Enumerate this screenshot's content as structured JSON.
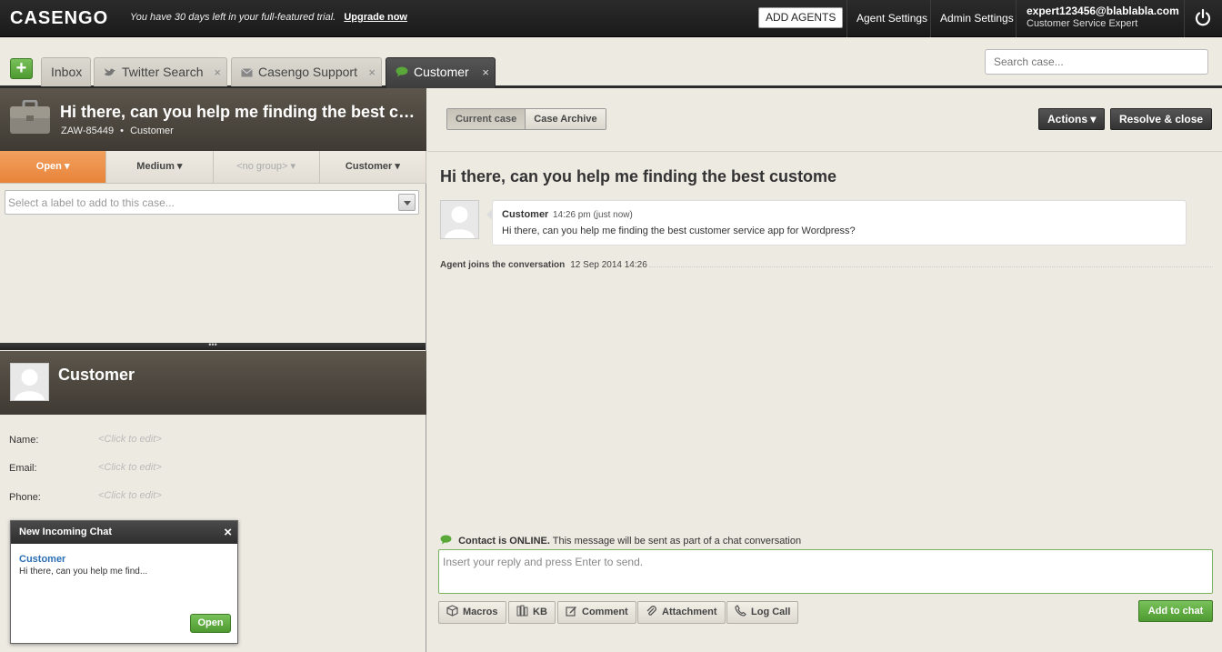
{
  "topbar": {
    "logo": "CASENGO",
    "trial_text": "You have 30 days left in your full-featured trial.",
    "upgrade_link": "Upgrade now",
    "add_agents": "ADD AGENTS",
    "agent_settings": "Agent Settings",
    "admin_settings": "Admin Settings",
    "user_email": "expert123456@blablabla.com",
    "user_role": "Customer Service Expert",
    "power_icon": "power-icon"
  },
  "tabs": {
    "add_label": "+",
    "items": [
      {
        "label": "Inbox"
      },
      {
        "label": "Twitter Search",
        "icon": "twitter-bird-icon"
      },
      {
        "label": "Casengo Support",
        "icon": "envelope-icon"
      },
      {
        "label": "Customer",
        "icon": "chat-bubble-icon"
      }
    ],
    "close_glyph": "×"
  },
  "search": {
    "placeholder": "Search case..."
  },
  "case": {
    "title": "Hi there, can you help me finding the best customer service app for Wordpress?",
    "id": "ZAW-85449",
    "separator": "•",
    "source": "Customer",
    "status": "Open",
    "priority": "Medium",
    "group": "<no group>",
    "assignee": "Customer",
    "label_placeholder": "Select a label to add to this case..."
  },
  "customer": {
    "name": "Customer",
    "fields": [
      {
        "label": "Name:",
        "value": "<Click to edit>"
      },
      {
        "label": "Email:",
        "value": "<Click to edit>"
      },
      {
        "label": "Phone:",
        "value": "<Click to edit>"
      }
    ]
  },
  "popup": {
    "title": "New Incoming Chat",
    "close": "×",
    "from": "Customer",
    "message": "Hi there, can you help me find...",
    "open_label": "Open"
  },
  "conversation": {
    "toggle_current": "Current case",
    "toggle_archive": "Case Archive",
    "actions_label": "Actions ▾",
    "resolve_label": "Resolve & close",
    "title": "Hi there, can you help me finding the best custome",
    "message": {
      "author": "Customer",
      "time": "14:26 pm (just now)",
      "text": "Hi there, can you help me finding the best customer service app for Wordpress?"
    },
    "event": {
      "label": "Agent joins the conversation",
      "time": "12 Sep 2014 14:26"
    }
  },
  "reply": {
    "status_bold": "Contact is ONLINE.",
    "status_rest": "This message will be sent as part of a chat conversation",
    "placeholder": "Insert your reply and press Enter to send.",
    "tools": [
      {
        "label": "Macros",
        "icon": "box-icon"
      },
      {
        "label": "KB",
        "icon": "books-icon"
      },
      {
        "label": "Comment",
        "icon": "edit-icon"
      },
      {
        "label": "Attachment",
        "icon": "paperclip-icon"
      },
      {
        "label": "Log Call",
        "icon": "phone-icon"
      }
    ],
    "send_label": "Add to chat"
  },
  "splitter_glyph": "•••",
  "colors": {
    "accent_green": "#5aa83a",
    "status_orange": "#e8843a",
    "dark_header": "#3f3a33"
  }
}
